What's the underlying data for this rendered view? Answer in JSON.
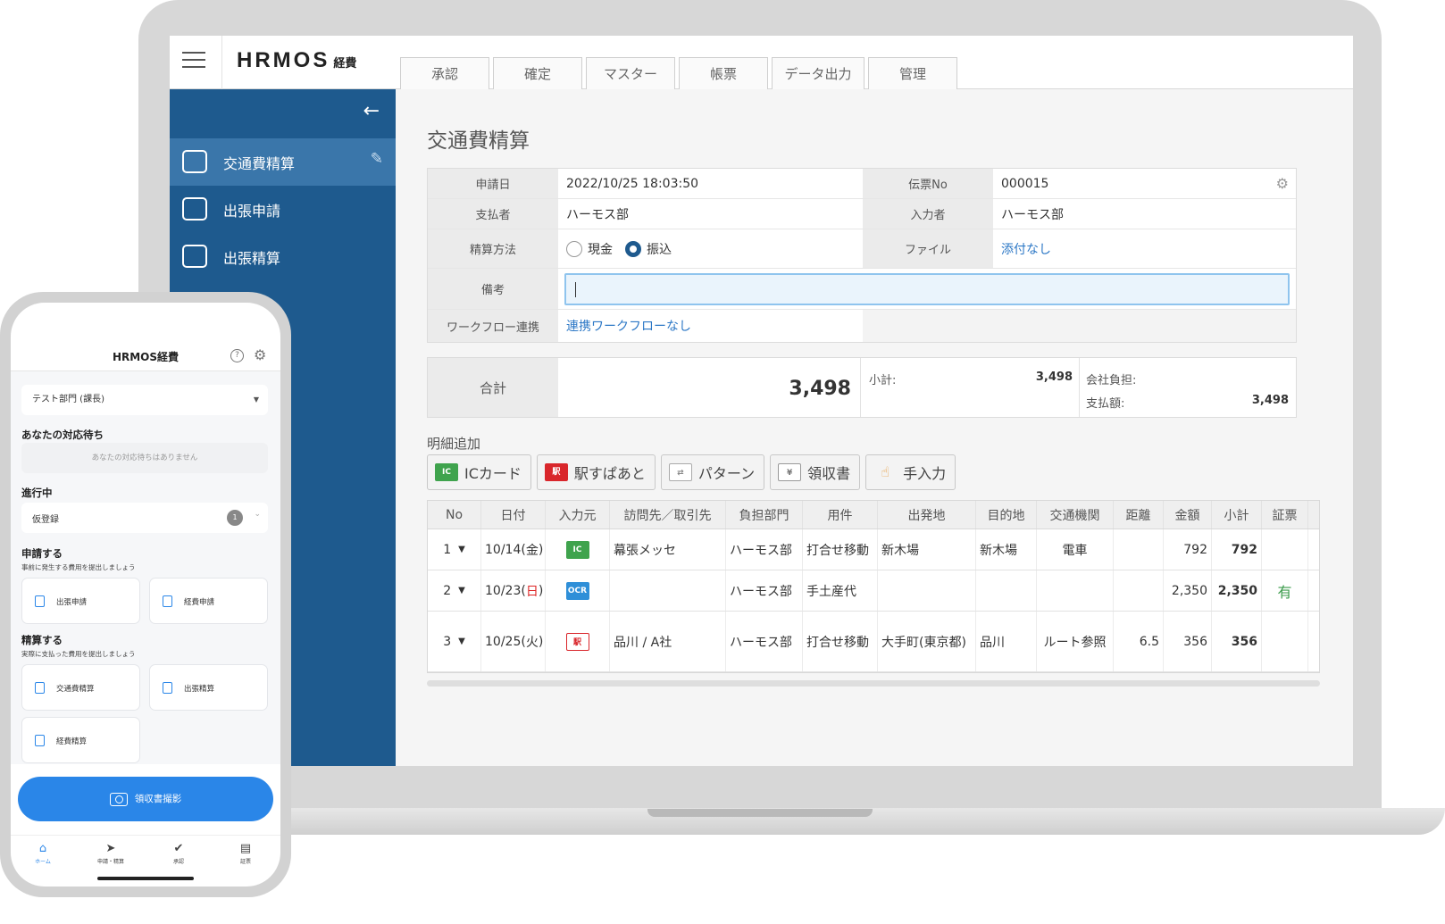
{
  "app": {
    "logo": "HRMOS",
    "logo_sub": "経費",
    "tabs": [
      "承認",
      "確定",
      "マスター",
      "帳票",
      "データ出力",
      "管理"
    ]
  },
  "sidebar": {
    "back_icon": "arrow-left-icon",
    "items": [
      {
        "label": "交通費精算",
        "icon": "train-icon",
        "active": true
      },
      {
        "label": "出張申請",
        "icon": "briefcase-icon"
      },
      {
        "label": "出張精算",
        "icon": "briefcase-icon"
      }
    ]
  },
  "form": {
    "title": "交通費精算",
    "labels": {
      "apply_date": "申請日",
      "voucher_no": "伝票No",
      "payer": "支払者",
      "entrant": "入力者",
      "method": "精算方法",
      "file": "ファイル",
      "memo": "備考",
      "workflow": "ワークフロー連携"
    },
    "values": {
      "apply_date": "2022/10/25 18:03:50",
      "voucher_no": "000015",
      "payer": "ハーモス部",
      "entrant": "ハーモス部",
      "method_cash": "現金",
      "method_transfer": "振込",
      "method_selected": "振込",
      "file": "添付なし",
      "memo": "",
      "workflow": "連携ワークフローなし"
    }
  },
  "totals": {
    "total_label": "合計",
    "total_value": "3,498",
    "subtotal_label": "小計:",
    "subtotal_value": "3,498",
    "company_label": "会社負担:",
    "company_value": "",
    "payment_label": "支払額:",
    "payment_value": "3,498"
  },
  "add_detail": {
    "label": "明細追加",
    "buttons": [
      {
        "label": "ICカード",
        "icon": "ic-card-icon",
        "color": "#3fa34d"
      },
      {
        "label": "駅すぱあと",
        "icon": "ekispert-icon",
        "color": "#d9262b"
      },
      {
        "label": "パターン",
        "icon": "pattern-icon",
        "color": "#9a9a9a"
      },
      {
        "label": "領収書",
        "icon": "receipt-icon",
        "color": "#8a8a8a"
      },
      {
        "label": "手入力",
        "icon": "hand-icon",
        "color": "#e8a046"
      }
    ]
  },
  "detail_table": {
    "columns": [
      "No",
      "日付",
      "入力元",
      "訪問先／取引先",
      "負担部門",
      "用件",
      "出発地",
      "目的地",
      "交通機関",
      "距離",
      "金額",
      "小計",
      "証票"
    ],
    "rows": [
      {
        "no": "1",
        "date": "10/14(",
        "day": "金",
        "day_red": false,
        "src": "IC",
        "src_color": "#3fa34d",
        "dest": "幕張メッセ",
        "dept": "ハーモス部",
        "purpose": "打合せ移動",
        "from": "新木場",
        "to": "新木場",
        "transport": "電車",
        "distance": "",
        "amount": "792",
        "subtotal": "792",
        "evidence": ""
      },
      {
        "no": "2",
        "date": "10/23(",
        "day": "日",
        "day_red": true,
        "src": "OCR",
        "src_color": "#2f8fd8",
        "dest": "",
        "dept": "ハーモス部",
        "purpose": "手土産代",
        "from": "",
        "to": "",
        "transport": "",
        "distance": "",
        "amount": "2,350",
        "subtotal": "2,350",
        "evidence": "有"
      },
      {
        "no": "3",
        "date": "10/25(",
        "day": "火",
        "day_red": false,
        "src": "駅",
        "src_color": "#d9262b",
        "dest": "品川 / A社",
        "dept": "ハーモス部",
        "purpose": "打合せ移動",
        "from": "大手町(東京都)",
        "to": "品川",
        "transport": "ルート参照",
        "distance": "6.5",
        "amount": "356",
        "subtotal": "356",
        "evidence": ""
      }
    ]
  },
  "phone": {
    "title": "HRMOS経費",
    "dept_select": "テスト部門 (課長)",
    "waiting_title": "あなたの対応待ち",
    "waiting_empty": "あなたの対応待ちはありません",
    "in_progress_title": "進行中",
    "in_progress_item": "仮登録",
    "in_progress_count": "1",
    "apply_title": "申請する",
    "apply_sub": "事前に発生する費用を提出しましょう",
    "apply_buttons": [
      "出張申請",
      "経費申請"
    ],
    "settle_title": "精算する",
    "settle_sub": "実際に支払った費用を提出しましょう",
    "settle_buttons": [
      "交通費精算",
      "出張精算",
      "経費精算"
    ],
    "camera_button": "領収書撮影",
    "nav": [
      "ホーム",
      "申請・精算",
      "承認",
      "証票"
    ],
    "accent": "#2a86e8"
  }
}
